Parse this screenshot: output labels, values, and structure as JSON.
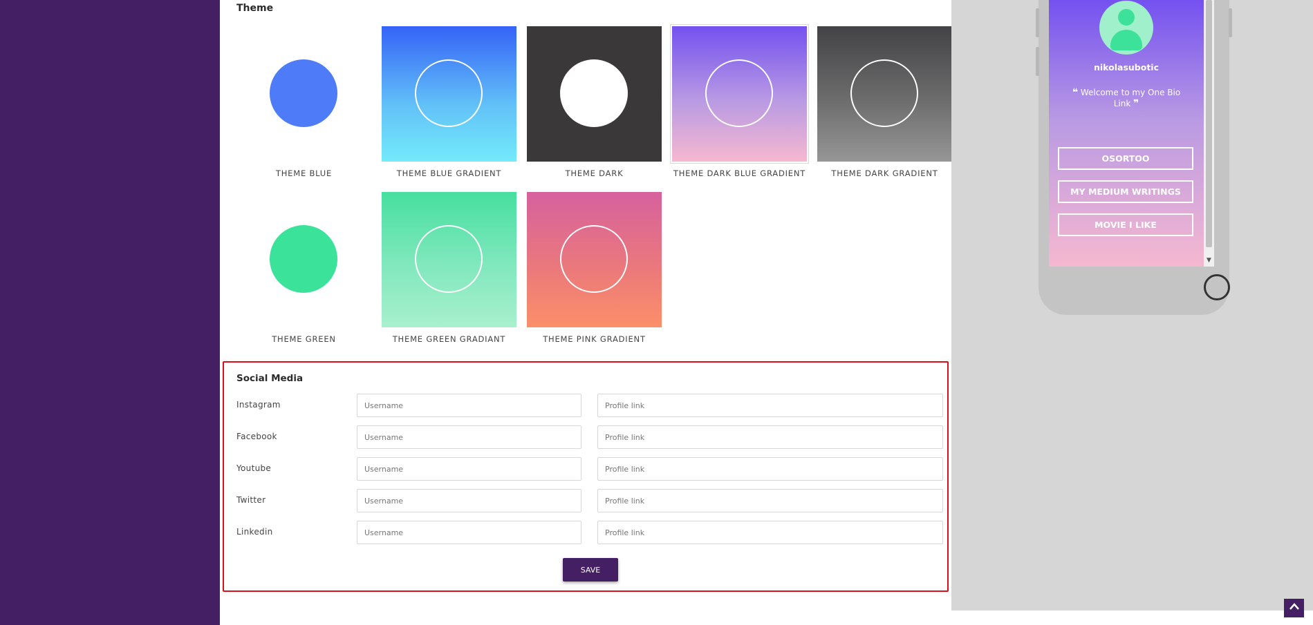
{
  "theme": {
    "title": "Theme",
    "tiles": [
      {
        "label": "THEME BLUE",
        "bg": "#ffffff",
        "circle": "#4e7bf7",
        "ring": false
      },
      {
        "label": "THEME BLUE GRADIENT",
        "bg": "linear-gradient(180deg,#3563f7 0%,#63c3f8 60%,#73eafa 100%)",
        "ring": true
      },
      {
        "label": "THEME DARK",
        "bg": "#3a3838",
        "circle": "#ffffff",
        "ring": false
      },
      {
        "label": "THEME DARK BLUE GRADIENT",
        "bg": "linear-gradient(180deg,#7451f0 0%,#b99ae3 55%,#f6b8d0 100%)",
        "ring": true,
        "selected": true
      },
      {
        "label": "THEME DARK GRADIENT",
        "bg": "linear-gradient(180deg,#434347 0%,#6d6d6d 55%,#969696 100%)",
        "ring": true
      },
      {
        "label": "THEME GREEN",
        "bg": "#ffffff",
        "circle": "#3ae29a",
        "ring": false
      },
      {
        "label": "THEME GREEN GRADIANT",
        "bg": "linear-gradient(180deg,#46dfa0 0%,#82e8bd 55%,#a8f0cd 100%)",
        "ring": true
      },
      {
        "label": "THEME PINK GRADIENT",
        "bg": "linear-gradient(180deg,#d6619e 0%,#ea787c 55%,#fc8f69 100%)",
        "ring": true
      }
    ]
  },
  "social": {
    "title": "Social Media",
    "username_placeholder": "Username",
    "profile_placeholder": "Profile link",
    "rows": [
      {
        "name": "Instagram"
      },
      {
        "name": "Facebook"
      },
      {
        "name": "Youtube"
      },
      {
        "name": "Twitter"
      },
      {
        "name": "Linkedin"
      }
    ],
    "save_label": "SAVE"
  },
  "preview": {
    "username": "nikolasubotic",
    "bio": "Welcome to my One Bio Link",
    "links": [
      "OSORTOO",
      "MY MEDIUM WRITINGS",
      "MOVIE I LIKE"
    ]
  },
  "colors": {
    "sidebar": "#451f63",
    "accent": "#451f63",
    "highlight_border": "#d9101a"
  }
}
